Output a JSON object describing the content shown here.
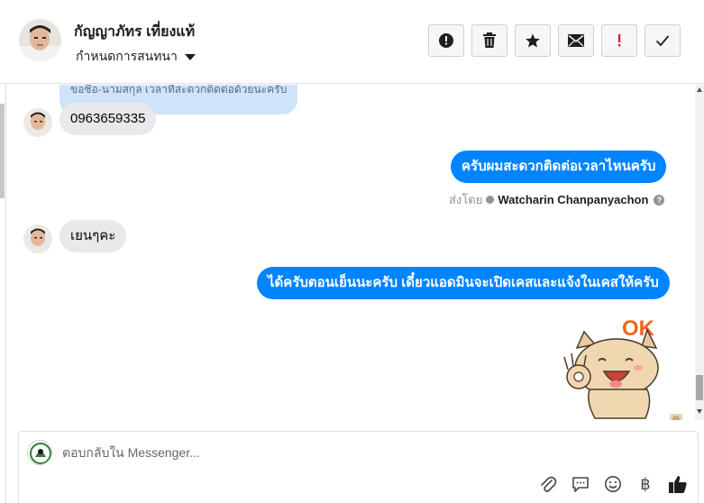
{
  "header": {
    "contact_name": "กัญญาภัทร เที่ยงแท้",
    "assign_label": "กำหนดการสนทนา"
  },
  "messages": {
    "partial_text": "ขอชื่อ-นามสกุล เวลาที่สะดวกติดต่อด้วยนะครับ",
    "customer_phone": "0963659335",
    "agent_reply_1": "ครับผมสะดวกติดต่อเวลาไหนครับ",
    "sent_by_prefix": "ส่งโดย",
    "sent_by_agent": "Watcharin Chanpanyachon",
    "sent_by_help": "?",
    "customer_reply": "เยนๆคะ",
    "agent_reply_2": "ได้ครับตอนเย็นนะครับ เดี๋ยวแอดมินจะเปิดเคสและแจ้งในเคสให้ครับ",
    "sticker_text": "OK"
  },
  "composer": {
    "placeholder": "ตอบกลับใน Messenger...",
    "baht_symbol": "฿"
  },
  "colors": {
    "outgoing_bubble": "#0084ff",
    "incoming_bubble": "#e9e9eb",
    "flag_red": "#e4002b"
  }
}
